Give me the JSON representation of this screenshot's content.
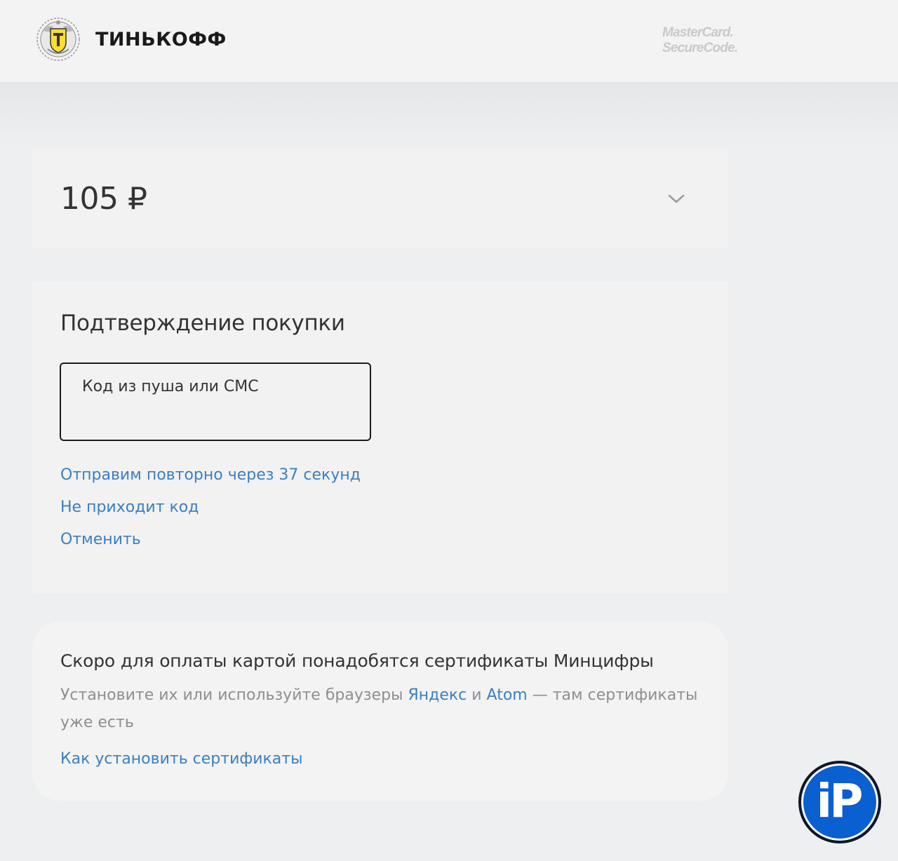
{
  "header": {
    "brand_name": "ТИНЬКОФФ",
    "securecode_line1": "MasterCard.",
    "securecode_line2": "SecureCode."
  },
  "amount_card": {
    "amount": "105 ₽",
    "expand_icon": "chevron-down-icon"
  },
  "confirm_card": {
    "title": "Подтверждение покупки",
    "code_field_label": "Код из пуша или СМС",
    "code_field_value": "",
    "resend_link": "Отправим повторно через 37 секунд",
    "no_code_link": "Не приходит код",
    "cancel_link": "Отменить"
  },
  "cert_card": {
    "title": "Скоро для оплаты картой понадобятся сертификаты Минцифры",
    "desc_part1": "Установите их или используйте браузеры ",
    "yandex_link": "Яндекс",
    "desc_part2": " и ",
    "atom_link": "Atom",
    "desc_part3": " — там сертификаты уже есть",
    "howto_link": "Как установить сертификаты"
  },
  "watermark": {
    "text": "iP"
  },
  "colors": {
    "link": "#3a7fc1",
    "background": "#eeeff1",
    "card": "#f2f2f2",
    "muted_text": "#8e8e93",
    "brand_yellow": "#ffdd2d",
    "badge_blue": "#0a5fd1"
  }
}
